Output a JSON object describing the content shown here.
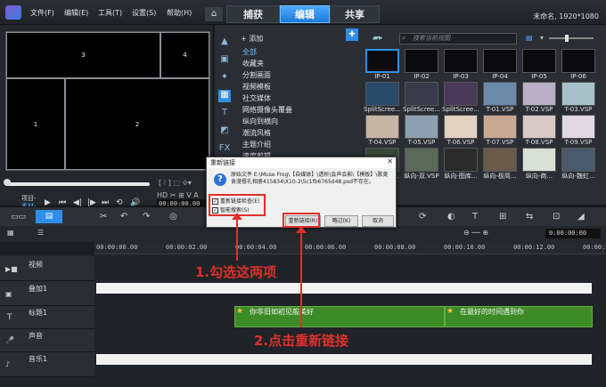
{
  "menu": [
    "文件(F)",
    "编辑(E)",
    "工具(T)",
    "设置(S)",
    "帮助(H)"
  ],
  "tabs": [
    "捕获",
    "编辑",
    "共享"
  ],
  "project_info": "未命名, 1920*1080",
  "preview": {
    "cells": [
      "3",
      "4",
      "1",
      "2"
    ],
    "mode_labels": [
      "项目-",
      "素材-"
    ],
    "timecode": "00:00:00.00"
  },
  "library": {
    "add_label": "添加",
    "search_placeholder": "搜索当前视图",
    "categories": [
      "全部",
      "收藏夹",
      "分割画面",
      "视频模板",
      "社交媒体",
      "网络摄像头覆叠",
      "纵向到横向",
      "潮流风格",
      "主题介绍",
      "速度剪辑"
    ],
    "thumbnails": [
      "IP-01",
      "IP-02",
      "IP-03",
      "IP-04",
      "IP-05",
      "IP-06",
      "SplitScree...",
      "SplitScree...",
      "SplitScree...",
      "T-01.VSP",
      "T-02.VSP",
      "T-03.VSP",
      "T-04.VSP",
      "T-05.VSP",
      "T-06.VSP",
      "T-07.VSP",
      "T-08.VSP",
      "T-09.VSP",
      "纵向-黑猫...",
      "纵向-双.VSP",
      "纵向-图库...",
      "纵向-极简...",
      "纵向-商...",
      "纵向-魏虹..."
    ]
  },
  "timeline": {
    "ruler": [
      "00:00:00.00",
      "00:00:02.00",
      "00:00:04.00",
      "00:00:06.00",
      "00:00:08.00",
      "00:00:10.00",
      "00:00:12.00",
      "00:00:1"
    ],
    "timecode": "0:00:00:00",
    "tracks": [
      "视频",
      "叠加1",
      "标题1",
      "声音",
      "音乐1"
    ],
    "title_clips": [
      "你非旧如初见般美好",
      "在最好的时间遇到你"
    ]
  },
  "dialog": {
    "title": "重新链接",
    "message": "原始文件 E:\\Muse Frog\\【自媒体】\\透析\\会声会影\\【模板】\\歌美食漫餐礼相册415834\\X10-2\\5c1fb6765d48.psd不存在。",
    "options": [
      "重新链接检查(E)",
      "智能搜索(S)"
    ],
    "buttons": [
      "重新链接(R)",
      "略过(K)",
      "取消"
    ]
  },
  "annotations": {
    "step1": "1.勾选这两项",
    "step2": "2.点击重新链接"
  },
  "colors": {
    "accent": "#2f8fe8",
    "annotation": "#e0302c",
    "title_clip": "#3d8b27"
  }
}
